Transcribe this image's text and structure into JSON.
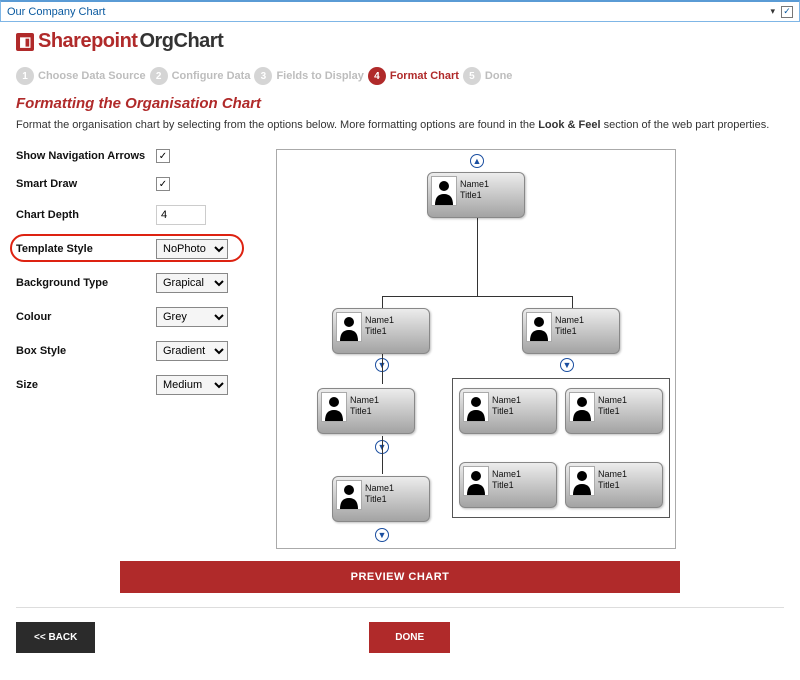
{
  "titlebar": {
    "title": "Our Company Chart"
  },
  "brand": {
    "a": "Sharepoint",
    "b": "OrgChart"
  },
  "steps": [
    {
      "num": "1",
      "label": "Choose Data Source",
      "active": false
    },
    {
      "num": "2",
      "label": "Configure Data",
      "active": false
    },
    {
      "num": "3",
      "label": "Fields to Display",
      "active": false
    },
    {
      "num": "4",
      "label": "Format Chart",
      "active": true
    },
    {
      "num": "5",
      "label": "Done",
      "active": false
    }
  ],
  "section": {
    "title": "Formatting the Organisation Chart",
    "desc_a": "Format the organisation chart by selecting from the options below. More formatting options are found in the ",
    "desc_bold": "Look & Feel",
    "desc_b": " section of the web part properties."
  },
  "options": {
    "show_nav_label": "Show Navigation Arrows",
    "show_nav_checked": true,
    "smart_draw_label": "Smart Draw",
    "smart_draw_checked": true,
    "chart_depth_label": "Chart Depth",
    "chart_depth_value": "4",
    "template_style_label": "Template Style",
    "template_style_value": "NoPhoto",
    "background_type_label": "Background Type",
    "background_type_value": "Grapical",
    "colour_label": "Colour",
    "colour_value": "Grey",
    "box_style_label": "Box Style",
    "box_style_value": "Gradient",
    "size_label": "Size",
    "size_value": "Medium"
  },
  "node": {
    "name": "Name1",
    "title": "Title1"
  },
  "buttons": {
    "preview": "PREVIEW CHART",
    "back": "<< BACK",
    "done": "DONE"
  }
}
